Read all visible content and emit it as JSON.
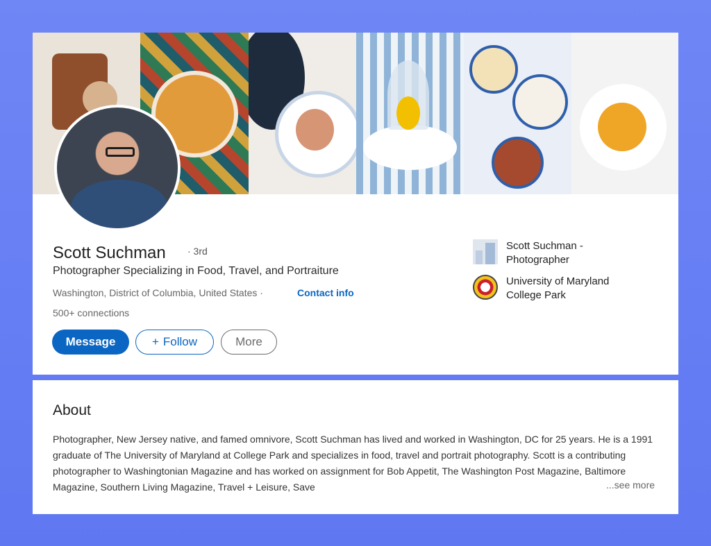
{
  "profile": {
    "name": "Scott Suchman",
    "degree": "· 3rd",
    "headline": "Photographer Specializing in Food, Travel, and Portraiture",
    "location": "Washington, District of Columbia, United States ·",
    "contact_label": "Contact info",
    "connections": "500+ connections"
  },
  "actions": {
    "message": "Message",
    "follow": "Follow",
    "follow_icon": "plus-icon",
    "more": "More"
  },
  "sidebar": {
    "company": "Scott Suchman - Photographer",
    "school": "University of Maryland College Park"
  },
  "about": {
    "title": "About",
    "text": "Photographer, New Jersey native, and famed omnivore, Scott Suchman has lived and worked in Washington, DC for 25 years. He is a 1991 graduate of The University of Maryland at College Park and specializes in food, travel and portrait photography. Scott is a contributing photographer to Washingtonian Magazine and has worked on assignment for Bob Appetit, The Washington Post Magazine, Baltimore Magazine, Southern Living Magazine, Travel + Leisure, Save",
    "see_more": "...see more"
  },
  "colors": {
    "accent": "#0a66c2",
    "background": "#6f86f5"
  }
}
